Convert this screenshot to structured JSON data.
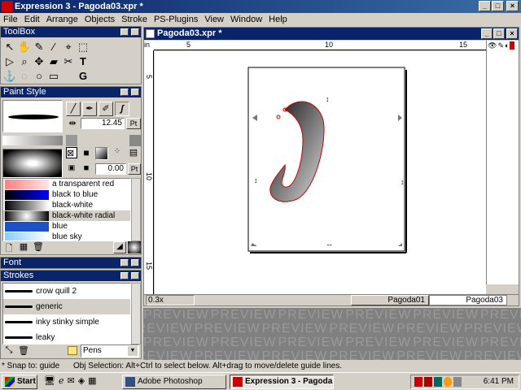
{
  "window": {
    "title": "Expression 3 - Pagoda03.xpr *"
  },
  "menu": [
    "File",
    "Edit",
    "Arrange",
    "Objects",
    "Stroke",
    "PS-Plugins",
    "View",
    "Window",
    "Help"
  ],
  "toolbox": {
    "title": "ToolBox",
    "text_tool": "T",
    "guide_tool": "G"
  },
  "paint_style": {
    "title": "Paint Style",
    "stroke_width": "12.45",
    "stroke_unit": "Pt",
    "offset": "0.00",
    "offset_unit": "Pt",
    "fills": [
      {
        "label": "a transparent red"
      },
      {
        "label": "black to blue"
      },
      {
        "label": "black-white"
      },
      {
        "label": "black-white radial",
        "selected": true
      },
      {
        "label": "blue"
      },
      {
        "label": "blue sky"
      }
    ]
  },
  "font_panel": {
    "title": "Font"
  },
  "strokes_panel": {
    "title": "Strokes",
    "items": [
      "crow quill 2",
      "generic",
      "inky stinky simple",
      "leaky"
    ],
    "selected": "generic",
    "category": "Pens"
  },
  "document": {
    "title": "Pagoda03.xpr *",
    "ruler_unit": "in",
    "ruler_h": [
      "5",
      "10",
      "15"
    ],
    "ruler_v": [
      "5",
      "10",
      "15"
    ],
    "zoom": "0.3x",
    "page_tabs": [
      "Pagoda01",
      "Pagoda03"
    ]
  },
  "preview_watermark": "PREVIEW",
  "status": {
    "snap": "* Snap to: guide",
    "hint": "Obj Selection: Alt+Ctrl to select below. Alt+drag to move/delete guide lines."
  },
  "taskbar": {
    "start": "Start",
    "tasks": [
      "Adobe Photoshop",
      "Expression 3 - Pagoda..."
    ],
    "clock": "6:41 PM"
  },
  "colors": {
    "title_active": "#0a246a",
    "selection": "#cc0000",
    "face": "#d4d0c8"
  }
}
